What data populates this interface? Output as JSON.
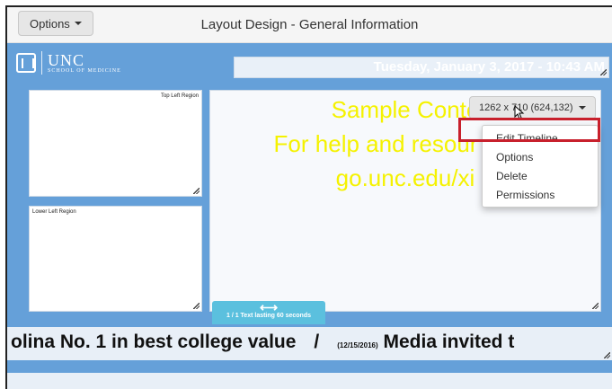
{
  "toolbar": {
    "options_label": "Options",
    "title": "Layout Design - General Information"
  },
  "header": {
    "logo_big": "UNC",
    "logo_small": "SCHOOL OF MEDICINE",
    "date_text": "Tuesday, January  3, 2017 - 10:43 AM"
  },
  "regions": {
    "top_left_label": "Top Left Region",
    "lower_left_label": "Lower Left Region"
  },
  "main": {
    "sample_line1": "Sample Conte",
    "sample_line2": "For help and resour",
    "sample_line3": "go.unc.edu/xi",
    "size_label": "1262 x 710 (624,132)"
  },
  "menu": {
    "items": [
      "Edit Timeline",
      "Options",
      "Delete",
      "Permissions"
    ]
  },
  "tab": {
    "arrow_icon": "left-right-arrow-icon",
    "label": "1 / 1 Text lasting 60 seconds"
  },
  "ticker": {
    "text_a": "olina No. 1 in best college value",
    "separator": "/",
    "date": "(12/15/2016)",
    "text_b": "Media invited t"
  },
  "colors": {
    "canvas_blue": "#65a0d9",
    "sample_yellow": "#f5f200",
    "highlight_red": "#c8202c",
    "tab_cyan": "#5bc0de"
  }
}
